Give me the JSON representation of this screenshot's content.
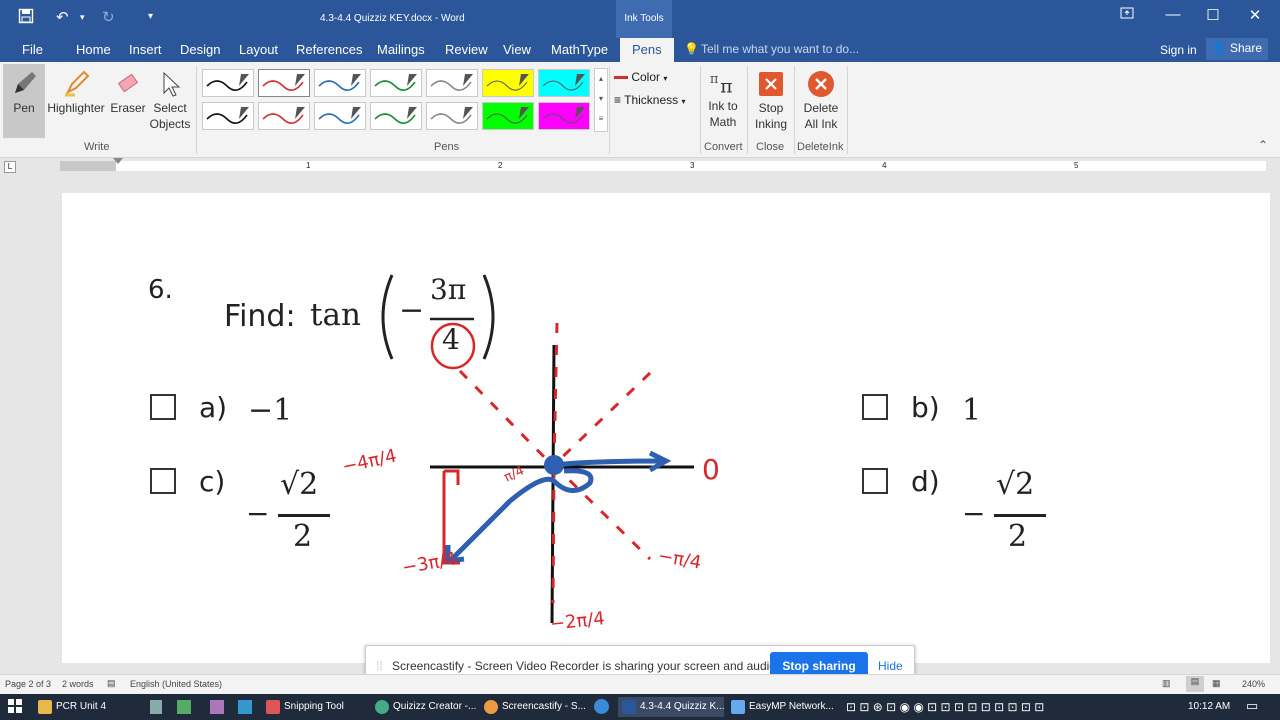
{
  "window": {
    "title": "4.3-4.4 Quizziz KEY.docx - Word",
    "context_tab": "Ink Tools"
  },
  "tabs": [
    "File",
    "Home",
    "Insert",
    "Design",
    "Layout",
    "References",
    "Mailings",
    "Review",
    "View",
    "MathType",
    "Pens"
  ],
  "active_tab": "Pens",
  "tell_me": "Tell me what you want to do...",
  "account": {
    "sign_in": "Sign in",
    "share": "Share"
  },
  "ribbon": {
    "write": {
      "pen": "Pen",
      "highlighter": "Highlighter",
      "eraser": "Eraser",
      "select_1": "Select",
      "select_2": "Objects",
      "group": "Write"
    },
    "pens_group": "Pens",
    "pen_colors": [
      "#111111",
      "#d32f2f",
      "#2a6db5",
      "#1b8a3a",
      "#8a8a8a",
      "#ffff00",
      "#00ffff",
      "#111111",
      "#d32f2f",
      "#2a6db5",
      "#1b8a3a",
      "#8a8a8a",
      "#00ff00",
      "#ff00ff"
    ],
    "color_label": "Color",
    "thickness_label": "Thickness",
    "ink_to_math_1": "Ink to",
    "ink_to_math_2": "Math",
    "convert_group": "Convert",
    "stop_1": "Stop",
    "stop_2": "Inking",
    "close_group": "Close",
    "delete_1": "Delete",
    "delete_2": "All Ink",
    "deleteink_group": "DeleteInk"
  },
  "ruler": {
    "numbers": [
      "1",
      "2",
      "3",
      "4",
      "5"
    ]
  },
  "question": {
    "number": "6.",
    "find": "Find:",
    "func": "tan",
    "num": "3π",
    "den": "4",
    "minus": "−",
    "options": [
      {
        "label": "a)",
        "value": "−1"
      },
      {
        "label": "b)",
        "value": "1"
      },
      {
        "label": "c)",
        "minus": "−",
        "num": "√2",
        "den": "2"
      },
      {
        "label": "d)",
        "minus": "−",
        "num": "√2",
        "den": "2"
      }
    ]
  },
  "ink_labels": {
    "zero": "0",
    "neg_pi_4": "−π/4",
    "neg_2pi_4": "−2π/4",
    "neg_3pi_4": "−3π/4",
    "neg_4pi_4": "−4π/4",
    "pi_4": "π/4"
  },
  "status": {
    "page": "Page 2 of 3",
    "words": "2 words",
    "language": "English (United States)",
    "zoom": "240%"
  },
  "share_bar": {
    "text": "Screencastify - Screen Video Recorder is sharing your screen and audio.",
    "stop": "Stop sharing",
    "hide": "Hide"
  },
  "taskbar": {
    "items": [
      "PCR Unit 4",
      "Snipping Tool",
      "Quizizz Creator -...",
      "Screencastify - S...",
      "4.3-4.4 Quizziz K...",
      "EasyMP Network..."
    ],
    "time": "10:12 AM"
  }
}
